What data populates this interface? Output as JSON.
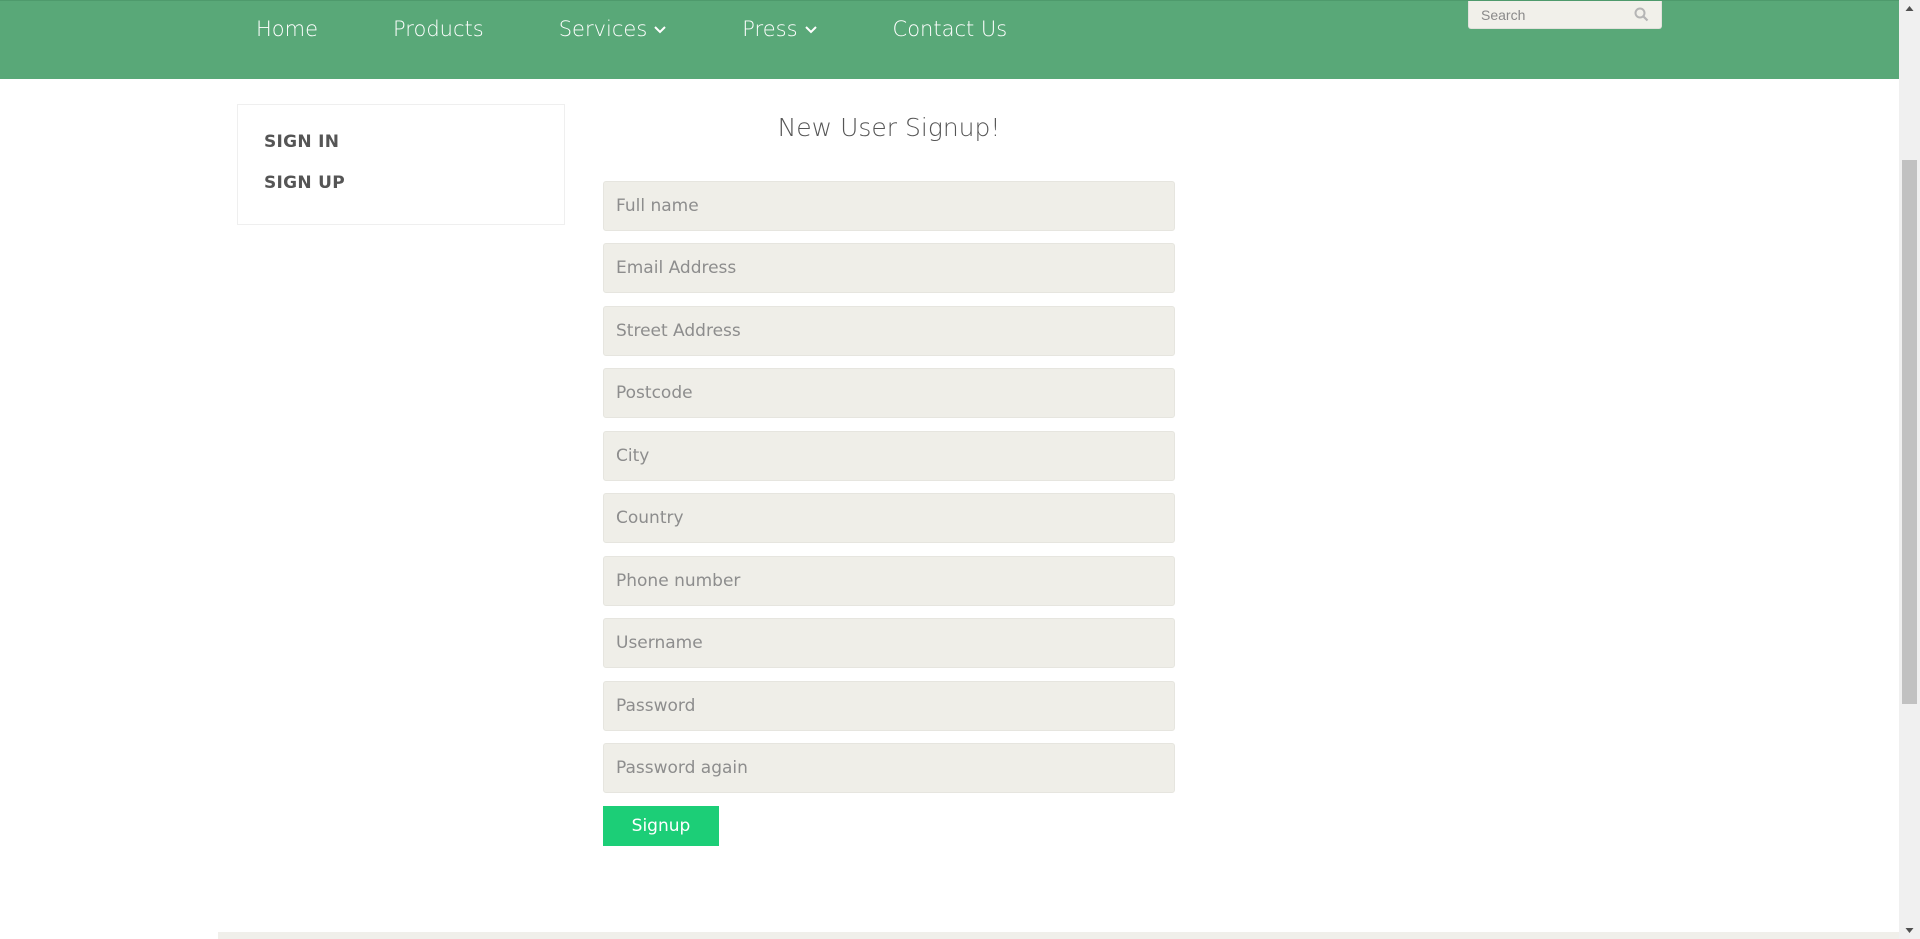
{
  "nav": {
    "items": [
      {
        "label": "Home",
        "has_dropdown": false
      },
      {
        "label": "Products",
        "has_dropdown": false
      },
      {
        "label": "Services",
        "has_dropdown": true
      },
      {
        "label": "Press",
        "has_dropdown": true
      },
      {
        "label": "Contact Us",
        "has_dropdown": false
      }
    ]
  },
  "search": {
    "placeholder": "Search",
    "icon": "search-icon"
  },
  "sidebar": {
    "items": [
      {
        "label": "SIGN IN"
      },
      {
        "label": "SIGN UP"
      }
    ]
  },
  "form": {
    "title": "New User Signup!",
    "fields": [
      {
        "placeholder": "Full name",
        "value": ""
      },
      {
        "placeholder": "Email Address",
        "value": ""
      },
      {
        "placeholder": "Street Address",
        "value": ""
      },
      {
        "placeholder": "Postcode",
        "value": ""
      },
      {
        "placeholder": "City",
        "value": ""
      },
      {
        "placeholder": "Country",
        "value": ""
      },
      {
        "placeholder": "Phone number",
        "value": ""
      },
      {
        "placeholder": "Username",
        "value": ""
      },
      {
        "placeholder": "Password",
        "value": ""
      },
      {
        "placeholder": "Password again",
        "value": ""
      }
    ],
    "submit_label": "Signup"
  },
  "colors": {
    "header": "#59a878",
    "button": "#1cce77",
    "field_bg": "#efeee8"
  }
}
